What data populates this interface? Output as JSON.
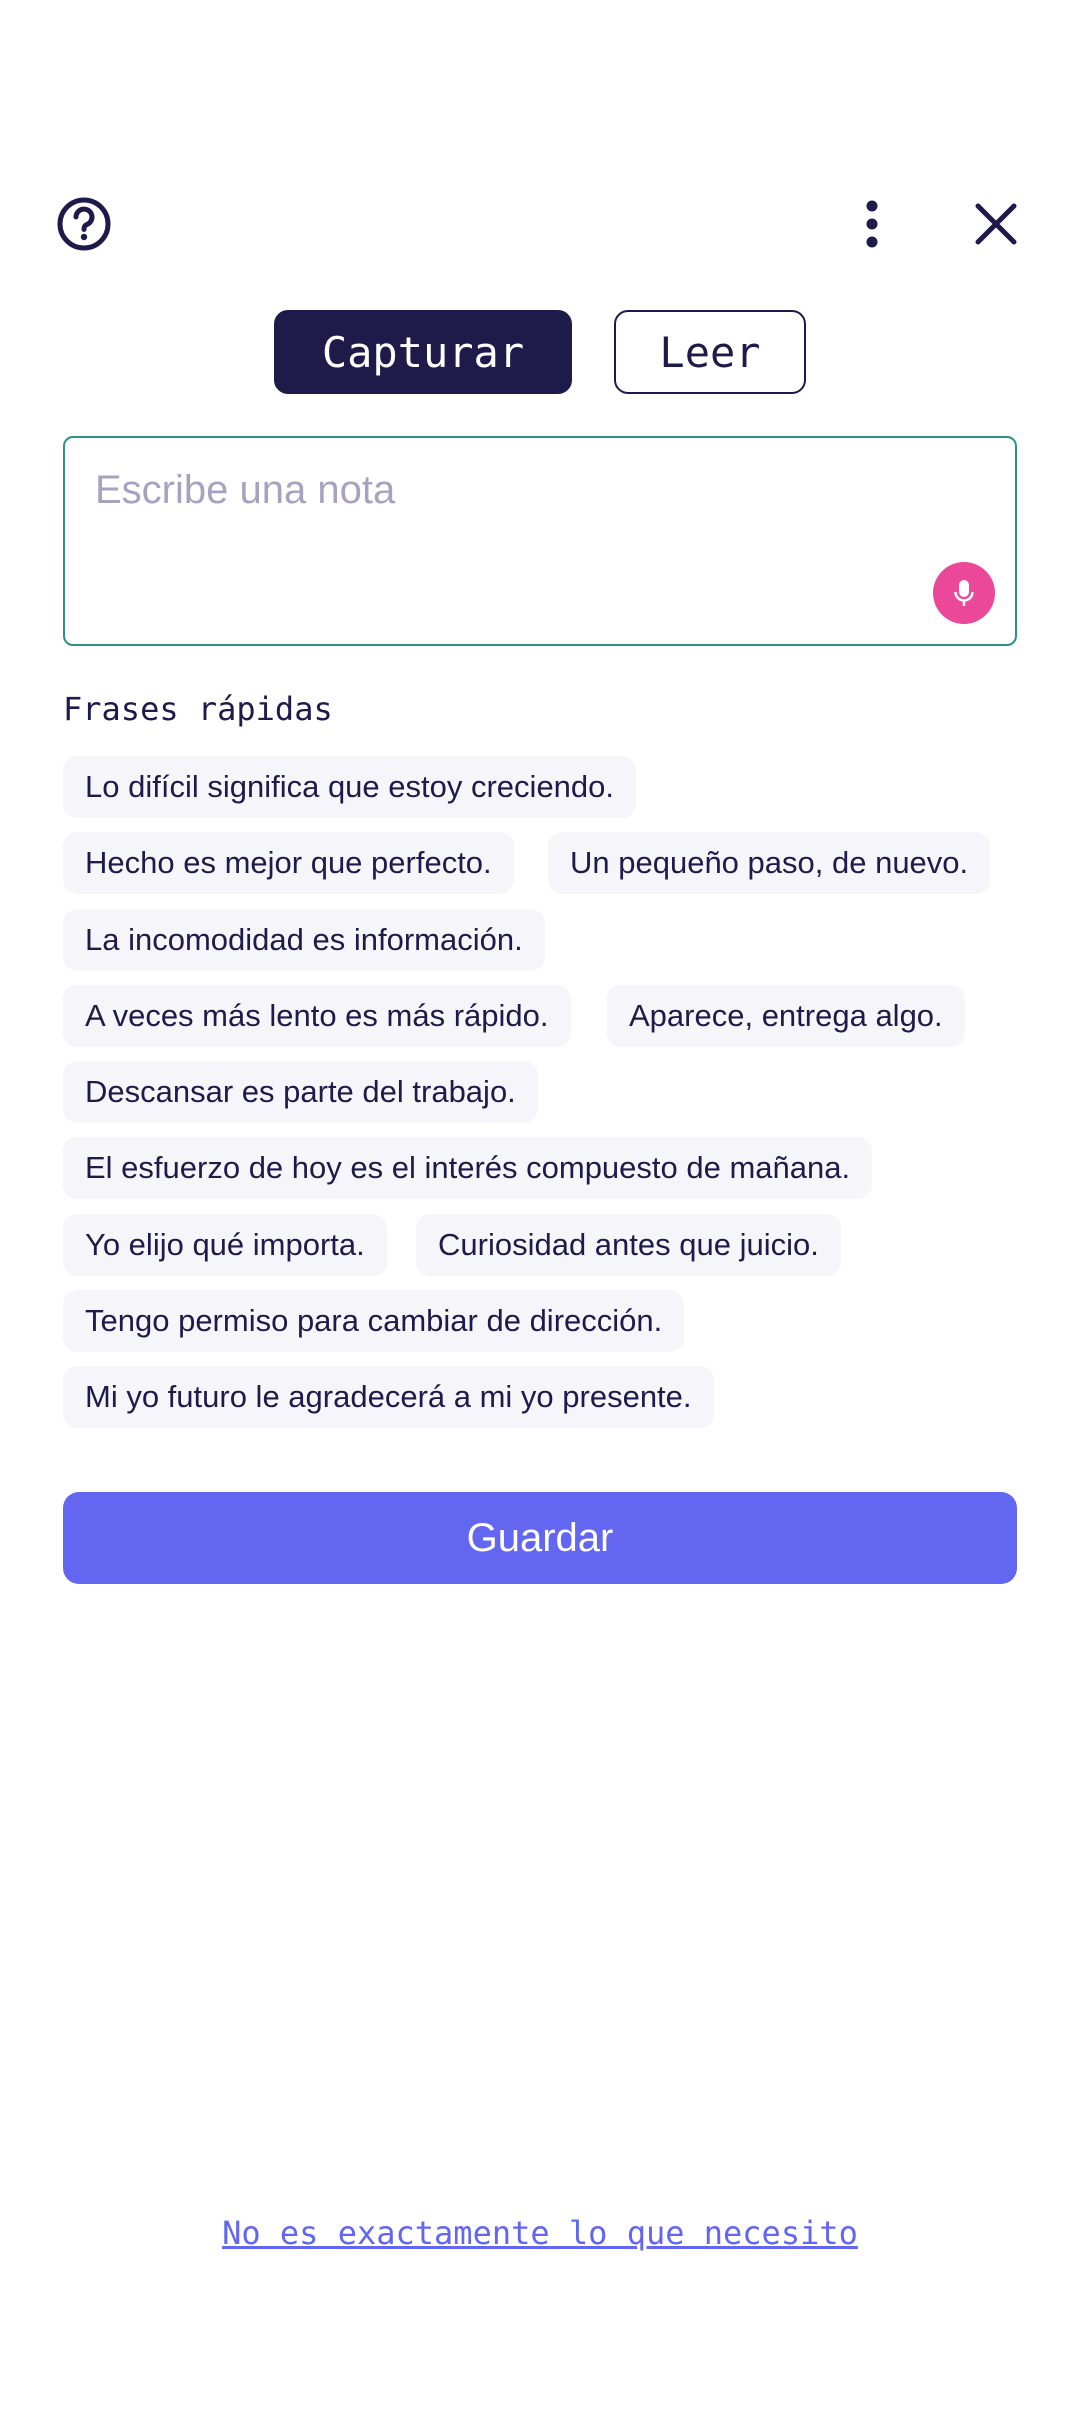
{
  "header": {
    "help_icon": "help-circle-icon",
    "more_icon": "more-vertical-icon",
    "close_icon": "close-icon"
  },
  "tabs": [
    {
      "label": "Capturar",
      "active": true
    },
    {
      "label": "Leer",
      "active": false
    }
  ],
  "note": {
    "value": "",
    "placeholder": "Escribe una nota",
    "mic_icon": "microphone-icon"
  },
  "quick_phrases": {
    "title": "Frases rápidas",
    "items": [
      "Lo difícil significa que estoy creciendo.",
      "Hecho es mejor que perfecto.",
      "Un pequeño paso, de nuevo.",
      "La incomodidad es información.",
      "A veces más lento es más rápido.",
      "Aparece, entrega algo.",
      "Descansar es parte del trabajo.",
      "El esfuerzo de hoy es el interés compuesto de mañana.",
      "Yo elijo qué importa.",
      "Curiosidad antes que juicio.",
      "Tengo permiso para cambiar de dirección.",
      "Mi yo futuro le agradecerá a mi yo presente."
    ]
  },
  "save_label": "Guardar",
  "footer_link": "No es exactamente lo que necesito",
  "colors": {
    "primary_dark": "#1e1b4b",
    "accent": "#6366f1",
    "mic": "#ec4899",
    "input_border": "#2f8f86",
    "chip_bg": "#f6f6fa"
  }
}
